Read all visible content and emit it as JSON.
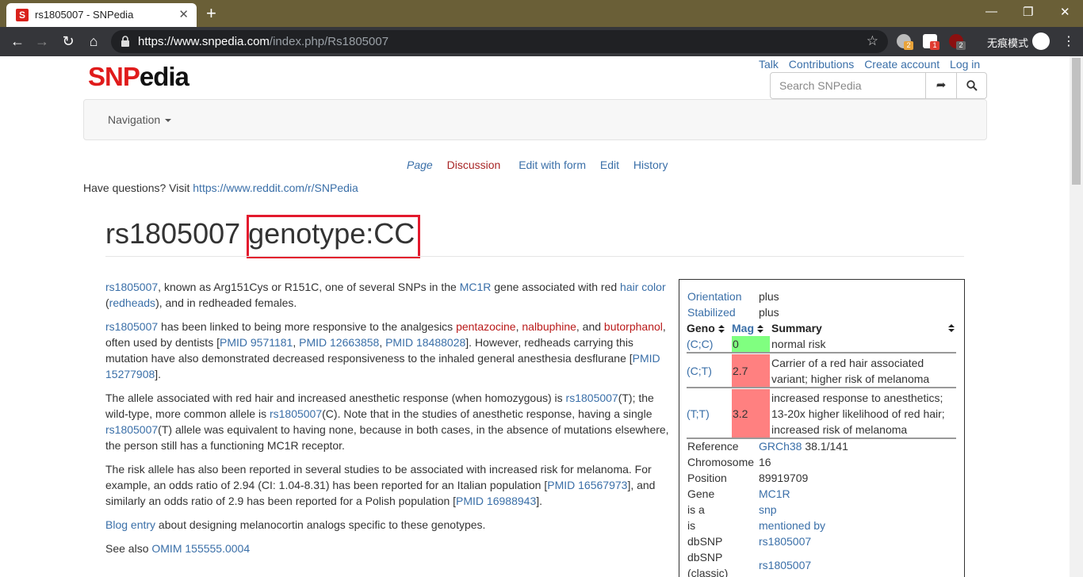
{
  "browser": {
    "tab_title": "rs1805007 - SNPedia",
    "favicon_letter": "S",
    "url_host": "https://www.snpedia.com",
    "url_path": "/index.php/Rs1805007",
    "incognito_label": "无痕模式",
    "extensions": [
      {
        "name": "ext-1",
        "badge": "2",
        "color": "#e8a33a"
      },
      {
        "name": "ext-2",
        "badge": "1",
        "color": "#e03c31"
      },
      {
        "name": "ext-3",
        "badge": "2",
        "color": "#666666"
      }
    ],
    "ext_badge_text": "uo"
  },
  "site": {
    "logo_snp": "SNP",
    "logo_edia": "edia",
    "user_links": [
      "Talk",
      "Contributions",
      "Create account",
      "Log in"
    ],
    "search_placeholder": "Search SNPedia",
    "nav_label": "Navigation"
  },
  "page_tabs": {
    "page": "Page",
    "discussion": "Discussion",
    "edit_form": "Edit with form",
    "edit": "Edit",
    "history": "History"
  },
  "questions": {
    "text": "Have questions? Visit ",
    "link": "https://www.reddit.com/r/SNPedia"
  },
  "heading": {
    "rsid": "rs1805007",
    "genotype": "genotype:CC"
  },
  "body": {
    "p1": {
      "a": "rs1805007",
      "b": ", known as Arg151Cys or R151C, one of several SNPs in the ",
      "c": "MC1R",
      "d": " gene associated with red ",
      "e": "hair color",
      "f": " (",
      "g": "redheads",
      "h": "), and in redheaded females."
    },
    "p2": {
      "a": "rs1805007",
      "b": " has been linked to being more responsive to the analgesics ",
      "c": "pentazocine",
      "d": ", ",
      "e": "nalbuphine",
      "f": ", and ",
      "g": "butorphanol",
      "h": ", often used by dentists [",
      "i": "PMID 9571181",
      "j": ", ",
      "k": "PMID 12663858",
      "l": ", ",
      "m": "PMID 18488028",
      "n": "]. However, redheads carrying this mutation have also demonstrated decreased responsiveness to the inhaled general anesthesia desflurane [",
      "o": "PMID 15277908",
      "p": "]."
    },
    "p3": {
      "a": "The allele associated with red hair and increased anesthetic response (when homozygous) is ",
      "b": "rs1805007",
      "c": "(T); the wild-type, more common allele is ",
      "d": "rs1805007",
      "e": "(C). Note that in the studies of anesthetic response, having a single ",
      "f": "rs1805007",
      "g": "(T) allele was equivalent to having none, because in both cases, in the absence of mutations elsewhere, the person still has a functioning MC1R receptor."
    },
    "p4": {
      "a": "The risk allele has also been reported in several studies to be associated with increased risk for melanoma. For example, an odds ratio of 2.94 (CI: 1.04-8.31) has been reported for an Italian population [",
      "b": "PMID 16567973",
      "c": "], and similarly an odds ratio of 2.9 has been reported for a Polish population [",
      "d": "PMID 16988943",
      "e": "]."
    },
    "p5": {
      "a": "Blog entry",
      "b": " about designing melanocortin analogs specific to these genotypes."
    },
    "p6": {
      "a": "See also ",
      "b": "OMIM 155555.0004"
    }
  },
  "infobox": {
    "orientation_label": "Orientation",
    "orientation_value": "plus",
    "stabilized_label": "Stabilized",
    "stabilized_value": "plus",
    "col_geno": "Geno",
    "col_mag": "Mag",
    "col_summary": "Summary",
    "rows": [
      {
        "geno": "(C;C)",
        "mag": "0",
        "summary": "normal risk",
        "color": "#80ff80"
      },
      {
        "geno": "(C;T)",
        "mag": "2.7",
        "summary": "Carrier of a red hair associated variant; higher risk of melanoma",
        "color": "#ff8080"
      },
      {
        "geno": "(T;T)",
        "mag": "3.2",
        "summary": "increased response to anesthetics; 13-20x higher likelihood of red hair; increased risk of melanoma",
        "color": "#ff8080"
      }
    ],
    "reference_label": "Reference",
    "reference_link": "GRCh38",
    "reference_value": " 38.1/141",
    "chromosome_label": "Chromosome",
    "chromosome_value": "16",
    "position_label": "Position",
    "position_value": "89919709",
    "gene_label": "Gene",
    "gene_value": "MC1R",
    "isa_label": "is a",
    "isa_value": "snp",
    "is_label": "is",
    "is_value": "mentioned by",
    "dbsnp_label": "dbSNP",
    "dbsnp_value": "rs1805007",
    "dbsnp_classic_label_1": "dbSNP",
    "dbsnp_classic_label_2": "(classic)",
    "dbsnp_classic_value": "rs1805007"
  }
}
